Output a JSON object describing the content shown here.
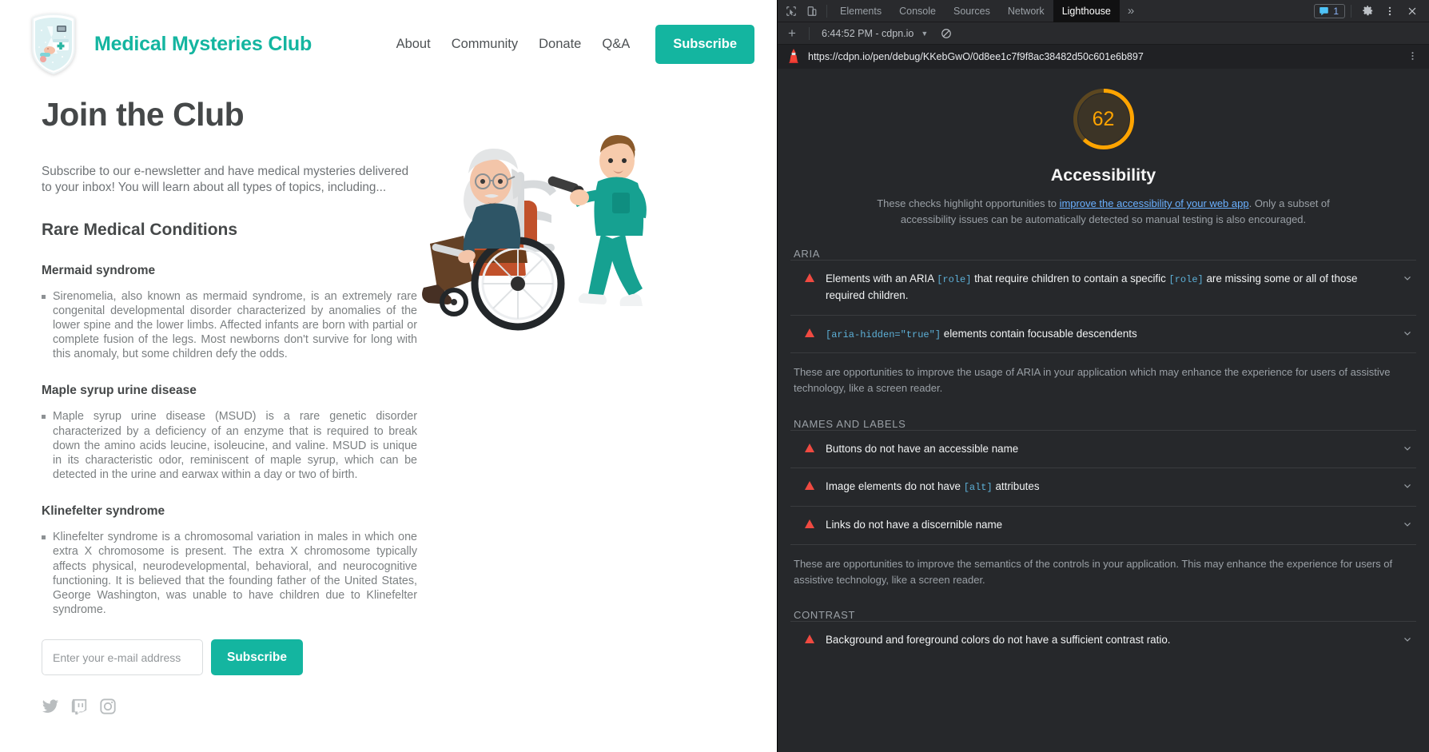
{
  "site": {
    "brand": "Medical Mysteries Club",
    "logo_icon": "medical-shield-logo",
    "nav": [
      {
        "label": "About"
      },
      {
        "label": "Community"
      },
      {
        "label": "Donate"
      },
      {
        "label": "Q&A"
      }
    ],
    "header_cta": "Subscribe",
    "page_title": "Join the Club",
    "intro": "Subscribe to our e-newsletter and have medical mysteries delivered to your inbox! You will learn about all types of topics, including...",
    "section_title": "Rare Medical Conditions",
    "conditions": [
      {
        "name": "Mermaid syndrome",
        "body": "Sirenomelia, also known as mermaid syndrome, is an extremely rare congenital developmental disorder characterized by anomalies of the lower spine and the lower limbs. Affected infants are born with partial or complete fusion of the legs. Most newborns don't survive for long with this anomaly, but some children defy the odds."
      },
      {
        "name": "Maple syrup urine disease",
        "body": "Maple syrup urine disease (MSUD) is a rare genetic disorder characterized by a deficiency of an enzyme that is required to break down the amino acids leucine, isoleucine, and valine. MSUD is unique in its characteristic odor, reminiscent of maple syrup, which can be detected in the urine and earwax within a day or two of birth."
      },
      {
        "name": "Klinefelter syndrome",
        "body": "Klinefelter syndrome is a chromosomal variation in males in which one extra X chromosome is present. The extra X chromosome typically affects physical, neurodevelopmental, behavioral, and neurocognitive functioning. It is believed that the founding father of the United States, George Washington, was unable to have children due to Klinefelter syndrome."
      }
    ],
    "form": {
      "email_placeholder": "Enter your e-mail address",
      "email_value": "",
      "submit_label": "Subscribe"
    },
    "socials": [
      {
        "icon": "twitter-icon"
      },
      {
        "icon": "twitch-icon"
      },
      {
        "icon": "instagram-icon"
      }
    ],
    "illustration_alt": "nurse-pushing-elderly-man-in-wheelchair",
    "accent_color": "#14b5a0"
  },
  "devtools": {
    "tabs": [
      {
        "label": "Elements",
        "active": false
      },
      {
        "label": "Console",
        "active": false
      },
      {
        "label": "Sources",
        "active": false
      },
      {
        "label": "Network",
        "active": false
      },
      {
        "label": "Lighthouse",
        "active": true
      }
    ],
    "overflow_label": "»",
    "issues_count": "1",
    "toolbar_icons": [
      "inspect-element-icon",
      "device-toolbar-icon",
      "issues-icon",
      "settings-gear-icon",
      "more-options-icon",
      "close-devtools-icon"
    ],
    "subbar": {
      "add_label": "+",
      "run_label": "6:44:52 PM - cdpn.io",
      "clear_icon": "clear-report-icon"
    },
    "url": "https://cdpn.io/pen/debug/KKebGwO/0d8ee1c7f9f8ac38482d50c601e6b897",
    "url_icon": "lighthouse-icon",
    "report": {
      "score": "62",
      "score_color": "#ffa400",
      "category": "Accessibility",
      "description_pre": "These checks highlight opportunities to ",
      "description_link": "improve the accessibility of your web app",
      "description_post": ". Only a subset of accessibility issues can be automatically detected so manual testing is also encouraged.",
      "groups": [
        {
          "title": "ARIA",
          "audits": [
            {
              "text_parts": [
                {
                  "t": "Elements with an ARIA ",
                  "code": false
                },
                {
                  "t": "[role]",
                  "code": true
                },
                {
                  "t": " that require children to contain a specific ",
                  "code": false
                },
                {
                  "t": "[role]",
                  "code": true
                },
                {
                  "t": " are missing some or all of those required children.",
                  "code": false
                }
              ]
            },
            {
              "text_parts": [
                {
                  "t": "[aria-hidden=\"true\"]",
                  "code": true
                },
                {
                  "t": " elements contain focusable descendents",
                  "code": false
                }
              ]
            }
          ],
          "description": "These are opportunities to improve the usage of ARIA in your application which may enhance the experience for users of assistive technology, like a screen reader."
        },
        {
          "title": "NAMES AND LABELS",
          "audits": [
            {
              "text_parts": [
                {
                  "t": "Buttons do not have an accessible name",
                  "code": false
                }
              ]
            },
            {
              "text_parts": [
                {
                  "t": "Image elements do not have ",
                  "code": false
                },
                {
                  "t": "[alt]",
                  "code": true
                },
                {
                  "t": " attributes",
                  "code": false
                }
              ]
            },
            {
              "text_parts": [
                {
                  "t": "Links do not have a discernible name",
                  "code": false
                }
              ]
            }
          ],
          "description": "These are opportunities to improve the semantics of the controls in your application. This may enhance the experience for users of assistive technology, like a screen reader."
        },
        {
          "title": "CONTRAST",
          "audits": [
            {
              "text_parts": [
                {
                  "t": "Background and foreground colors do not have a sufficient contrast ratio.",
                  "code": false
                }
              ]
            }
          ],
          "description": ""
        }
      ]
    }
  }
}
